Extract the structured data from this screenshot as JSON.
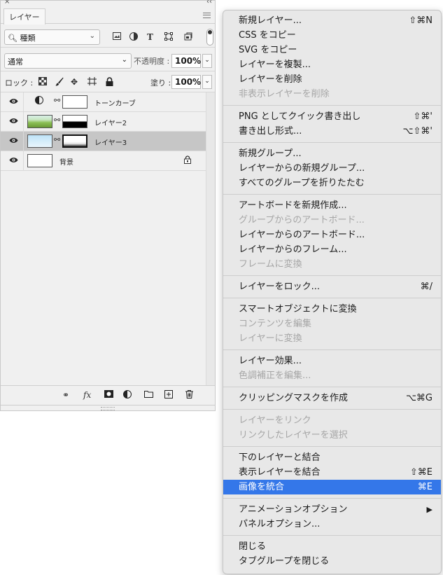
{
  "panel": {
    "close_glyph": "×",
    "collapse_glyph": "‹‹",
    "tab_label": "レイヤー",
    "filter": {
      "label": "種類",
      "icon": "search-icon"
    },
    "blend_mode": "通常",
    "opacity_label": "不透明度 :",
    "opacity_value": "100%",
    "lock_label": "ロック :",
    "fill_label": "塗り :",
    "fill_value": "100%",
    "layers": [
      {
        "name": "トーンカーブ",
        "type": "adjustment",
        "visible": true,
        "selected": false
      },
      {
        "name": "レイヤー2",
        "type": "pixel-with-mask",
        "visible": true,
        "selected": false
      },
      {
        "name": "レイヤー3",
        "type": "pixel-with-mask",
        "visible": true,
        "selected": true
      },
      {
        "name": "背景",
        "type": "background",
        "visible": true,
        "locked": true,
        "selected": false
      }
    ],
    "bottom_fx": "fx"
  },
  "menu": {
    "groups": [
      [
        {
          "label": "新規レイヤー...",
          "shortcut": "⇧⌘N",
          "enabled": true
        },
        {
          "label": "CSS をコピー",
          "shortcut": "",
          "enabled": true
        },
        {
          "label": "SVG をコピー",
          "shortcut": "",
          "enabled": true
        },
        {
          "label": "レイヤーを複製...",
          "shortcut": "",
          "enabled": true
        },
        {
          "label": "レイヤーを削除",
          "shortcut": "",
          "enabled": true
        },
        {
          "label": "非表示レイヤーを削除",
          "shortcut": "",
          "enabled": false
        }
      ],
      [
        {
          "label": "PNG としてクイック書き出し",
          "shortcut": "⇧⌘'",
          "enabled": true
        },
        {
          "label": "書き出し形式...",
          "shortcut": "⌥⇧⌘'",
          "enabled": true
        }
      ],
      [
        {
          "label": "新規グループ...",
          "shortcut": "",
          "enabled": true
        },
        {
          "label": "レイヤーからの新規グループ...",
          "shortcut": "",
          "enabled": true
        },
        {
          "label": "すべてのグループを折りたたむ",
          "shortcut": "",
          "enabled": true
        }
      ],
      [
        {
          "label": "アートボードを新規作成...",
          "shortcut": "",
          "enabled": true
        },
        {
          "label": "グループからのアートボード...",
          "shortcut": "",
          "enabled": false
        },
        {
          "label": "レイヤーからのアートボード...",
          "shortcut": "",
          "enabled": true
        },
        {
          "label": "レイヤーからのフレーム...",
          "shortcut": "",
          "enabled": true
        },
        {
          "label": "フレームに変換",
          "shortcut": "",
          "enabled": false
        }
      ],
      [
        {
          "label": "レイヤーをロック...",
          "shortcut": "⌘/",
          "enabled": true
        }
      ],
      [
        {
          "label": "スマートオブジェクトに変換",
          "shortcut": "",
          "enabled": true
        },
        {
          "label": "コンテンツを編集",
          "shortcut": "",
          "enabled": false
        },
        {
          "label": "レイヤーに変換",
          "shortcut": "",
          "enabled": false
        }
      ],
      [
        {
          "label": "レイヤー効果...",
          "shortcut": "",
          "enabled": true
        },
        {
          "label": "色調補正を編集...",
          "shortcut": "",
          "enabled": false
        }
      ],
      [
        {
          "label": "クリッピングマスクを作成",
          "shortcut": "⌥⌘G",
          "enabled": true
        }
      ],
      [
        {
          "label": "レイヤーをリンク",
          "shortcut": "",
          "enabled": false
        },
        {
          "label": "リンクしたレイヤーを選択",
          "shortcut": "",
          "enabled": false
        }
      ],
      [
        {
          "label": "下のレイヤーと結合",
          "shortcut": "",
          "enabled": true
        },
        {
          "label": "表示レイヤーを結合",
          "shortcut": "⇧⌘E",
          "enabled": true
        },
        {
          "label": "画像を統合",
          "shortcut": "⌘E",
          "enabled": true,
          "highlighted": true
        }
      ],
      [
        {
          "label": "アニメーションオプション",
          "shortcut": "▶",
          "enabled": true
        },
        {
          "label": "パネルオプション...",
          "shortcut": "",
          "enabled": true
        }
      ],
      [
        {
          "label": "閉じる",
          "shortcut": "",
          "enabled": true
        },
        {
          "label": "タブグループを閉じる",
          "shortcut": "",
          "enabled": true
        }
      ]
    ]
  },
  "colors": {
    "highlight": "#3477e9",
    "disabled_text": "#a6a6a6",
    "selected_layer": "#c6c6c6"
  }
}
